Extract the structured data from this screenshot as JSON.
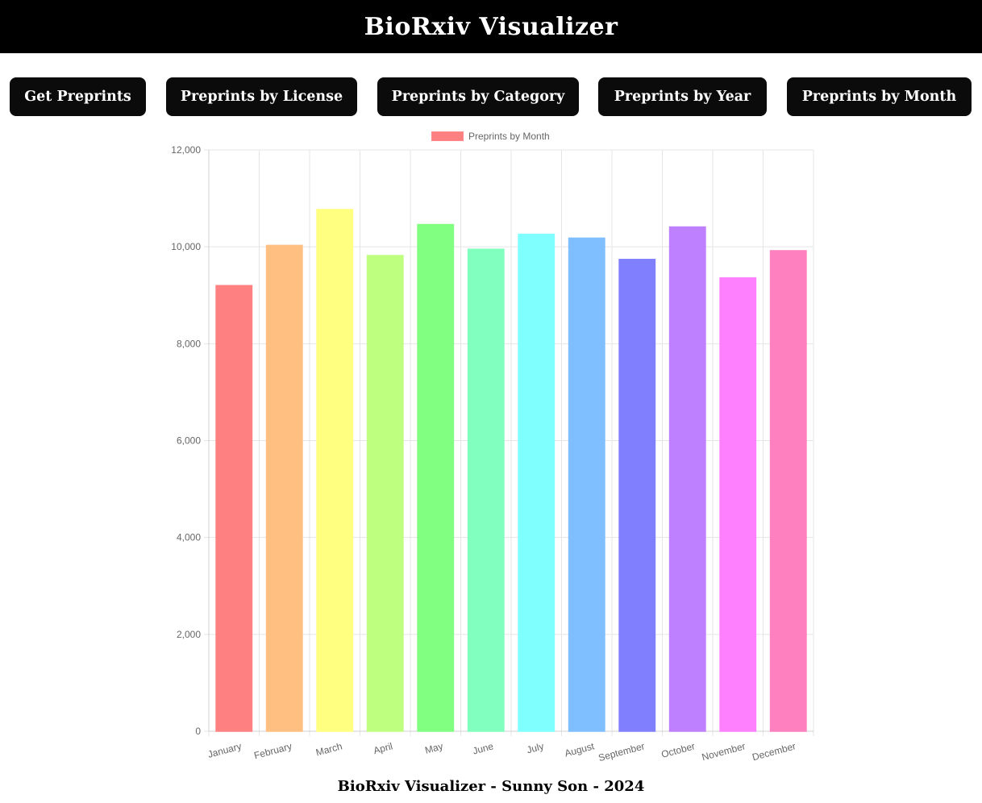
{
  "header": {
    "title": "BioRxiv Visualizer"
  },
  "nav": {
    "get_preprints": "Get Preprints",
    "by_license": "Preprints by License",
    "by_category": "Preprints by Category",
    "by_year": "Preprints by Year",
    "by_month": "Preprints by Month"
  },
  "chart_data": {
    "type": "bar",
    "categories": [
      "January",
      "February",
      "March",
      "April",
      "May",
      "June",
      "July",
      "August",
      "September",
      "October",
      "November",
      "December"
    ],
    "series": [
      {
        "name": "Preprints by Month",
        "values": [
          9200,
          10030,
          10770,
          9820,
          10460,
          9950,
          10260,
          10180,
          9740,
          10410,
          9360,
          9920
        ]
      }
    ],
    "ylim": [
      0,
      12000
    ],
    "yticks": [
      "0",
      "2,000",
      "4,000",
      "6,000",
      "8,000",
      "10,000",
      "12,000"
    ],
    "grid": true,
    "legend": "top",
    "colors": [
      "#ff8080",
      "#ffbf80",
      "#ffff80",
      "#bfff80",
      "#80ff80",
      "#80ffbf",
      "#80ffff",
      "#80bfff",
      "#8080ff",
      "#bf80ff",
      "#ff80ff",
      "#ff80bf"
    ]
  },
  "footer": {
    "text": "BioRxiv Visualizer - Sunny Son - 2024"
  }
}
